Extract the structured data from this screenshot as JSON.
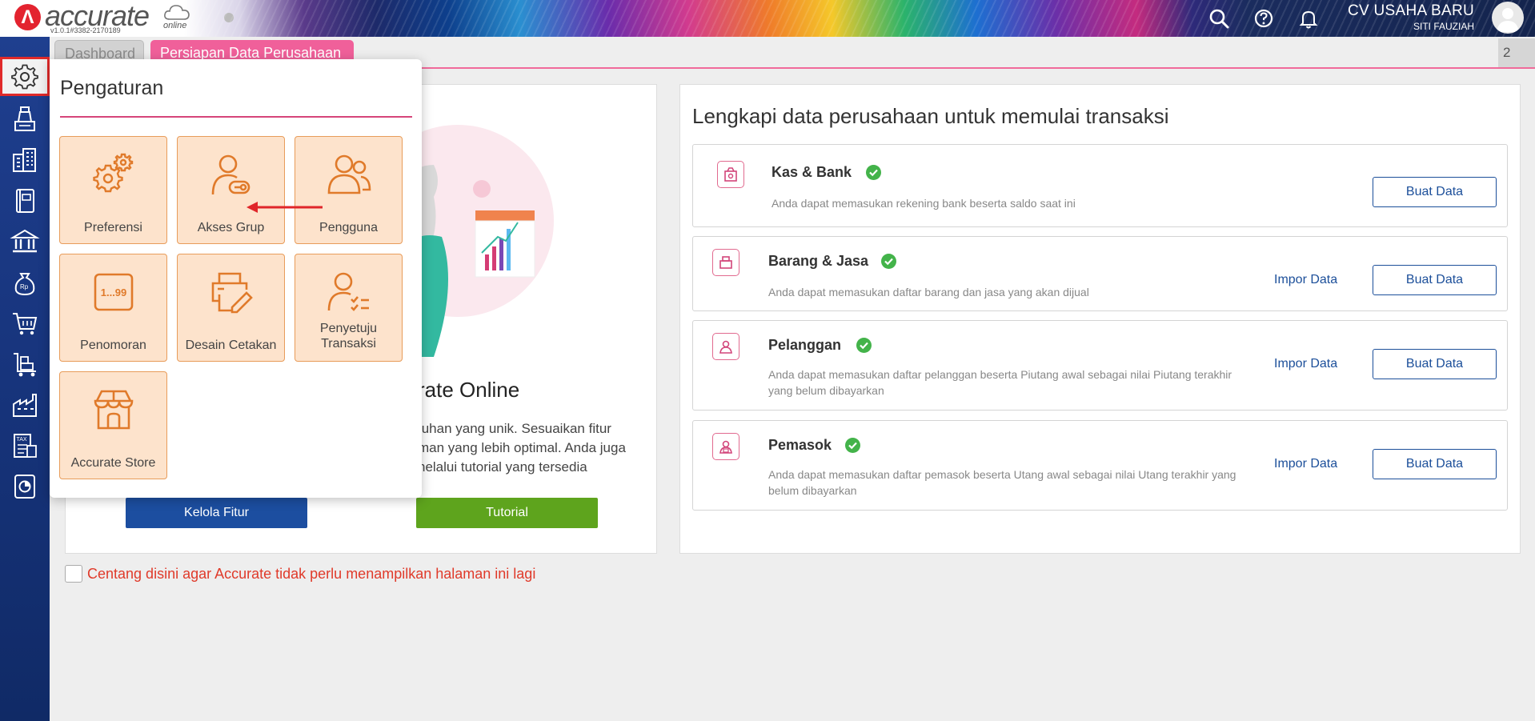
{
  "header": {
    "logo_text": "accurate",
    "logo_sub": "online",
    "version": "v1.0.1#3382-2170189",
    "company_name": "CV USAHA BARU",
    "user_name": "SITI FAUZIAH",
    "icons": [
      "search-icon",
      "help-icon",
      "bell-icon"
    ]
  },
  "sidebar": {
    "items": [
      "gear-icon",
      "cash-register-icon",
      "building-icon",
      "ledger-icon",
      "bank-icon",
      "money-bag-icon",
      "cart-icon",
      "delivery-cart-icon",
      "factory-icon",
      "tax-icon",
      "report-icon"
    ]
  },
  "tabs": {
    "items": [
      {
        "label": "Dashboard"
      },
      {
        "label": "Persiapan Data Perusahaan"
      }
    ],
    "count": "2"
  },
  "popup": {
    "title": "Pengaturan",
    "tiles": [
      {
        "label": "Preferensi",
        "icon": "gears-icon"
      },
      {
        "label": "Akses Grup",
        "icon": "user-key-icon"
      },
      {
        "label": "Pengguna",
        "icon": "users-icon"
      },
      {
        "label": "Penomoran",
        "icon": "numbering-icon",
        "icon_text": "1...99"
      },
      {
        "label": "Desain Cetakan",
        "icon": "printer-edit-icon"
      },
      {
        "label": "Penyetuju Transaksi",
        "icon": "user-approve-icon"
      },
      {
        "label": "Accurate Store",
        "icon": "store-icon"
      }
    ]
  },
  "left_panel": {
    "heading_partial": "rate Online",
    "body_lines": [
      "tuhan yang unik. Sesuaikan fitur",
      "man yang lebih optimal. Anda juga",
      "nelalui tutorial yang tersedia"
    ],
    "btn_kelola": "Kelola Fitur",
    "btn_tutorial": "Tutorial"
  },
  "right_panel": {
    "title": "Lengkapi data perusahaan untuk memulai transaksi",
    "cards": [
      {
        "title": "Kas & Bank",
        "desc": "Anda dapat memasukan rekening bank beserta saldo saat ini",
        "impor": "",
        "buat": "Buat Data"
      },
      {
        "title": "Barang & Jasa",
        "desc": "Anda dapat memasukan daftar barang dan jasa yang akan dijual",
        "impor": "Impor Data",
        "buat": "Buat Data"
      },
      {
        "title": "Pelanggan",
        "desc": "Anda dapat memasukan daftar pelanggan beserta Piutang awal sebagai nilai Piutang terakhir yang belum dibayarkan",
        "impor": "Impor Data",
        "buat": "Buat Data"
      },
      {
        "title": "Pemasok",
        "desc": "Anda dapat memasukan daftar pemasok beserta Utang awal sebagai nilai Utang terakhir yang belum dibayarkan",
        "impor": "Impor Data",
        "buat": "Buat Data"
      }
    ]
  },
  "footer_checkbox": {
    "label": "Centang disini agar Accurate tidak perlu menampilkan halaman ini lagi",
    "checked": false
  },
  "colors": {
    "accent_pink": "#f0609a",
    "primary_blue": "#1c4ea0",
    "tile_bg": "#fde3cc",
    "tile_icon": "#e07a2a",
    "success_green": "#43b34a",
    "warning_red": "#e03a2a"
  }
}
